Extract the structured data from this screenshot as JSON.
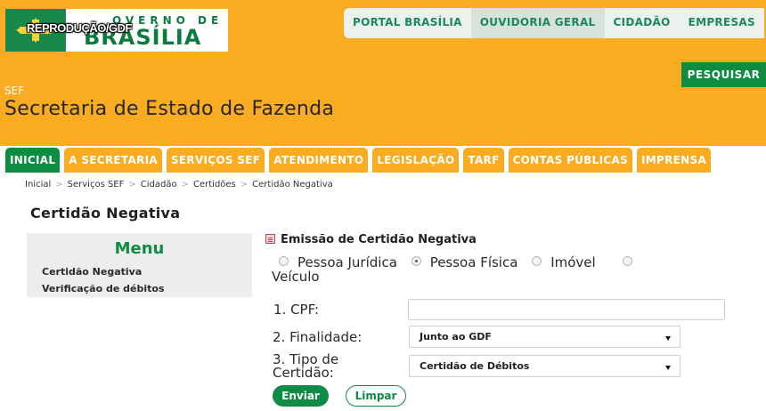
{
  "logo": {
    "watermark": "REPRODUÇÃO/GDF",
    "top_text": "OVERNO DE",
    "main_text": "BRASÍLIA"
  },
  "portal_nav": [
    "PORTAL BRASÍLIA",
    "OUVIDORIA GERAL",
    "CIDADÃO",
    "EMPRESAS"
  ],
  "search_label": "PESQUISAR",
  "header": {
    "acronym": "SEF",
    "title": "Secretaria de Estado de Fazenda"
  },
  "main_nav": [
    {
      "label": "INICIAL",
      "active": true
    },
    {
      "label": "A SECRETARIA",
      "active": false
    },
    {
      "label": "SERVIÇOS SEF",
      "active": false
    },
    {
      "label": "ATENDIMENTO",
      "active": false
    },
    {
      "label": "LEGISLAÇÃO",
      "active": false
    },
    {
      "label": "TARF",
      "active": false
    },
    {
      "label": "CONTAS PÚBLICAS",
      "active": false
    },
    {
      "label": "IMPRENSA",
      "active": false
    }
  ],
  "breadcrumb": [
    "Inicial",
    "Serviços SEF",
    "Cidadão",
    "Certidões",
    "Certidão Negativa"
  ],
  "breadcrumb_sep": ">",
  "page_title": "Certidão Negativa",
  "menu": {
    "title": "Menu",
    "items": [
      "Certidão Negativa",
      "Verificação de débitos"
    ]
  },
  "form": {
    "heading": "Emissão de Certidão Negativa",
    "radios": [
      {
        "label": "Pessoa Jurídica",
        "checked": false
      },
      {
        "label": "Pessoa Física",
        "checked": true
      },
      {
        "label": "Imóvel",
        "checked": false
      },
      {
        "label": "Veículo",
        "checked": false
      }
    ],
    "cpf_label": "1. CPF:",
    "cpf_value": "",
    "finalidade_label": "2. Finalidade:",
    "finalidade_value": "Junto ao GDF",
    "tipo_label_line1": "3. Tipo de",
    "tipo_label_line2": "Certidão:",
    "tipo_value": "Certidão de Débitos",
    "send_label": "Enviar",
    "clear_label": "Limpar"
  },
  "colors": {
    "header_orange": "#f9ab21",
    "brand_green": "#0f8c43",
    "menu_gray": "#ededed"
  }
}
